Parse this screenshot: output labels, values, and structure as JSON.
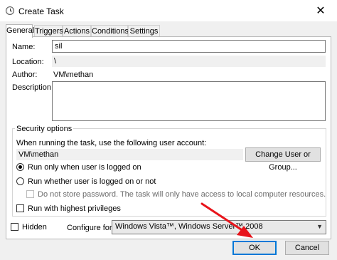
{
  "window": {
    "title": "Create Task",
    "close_glyph": "✕"
  },
  "tabs": [
    {
      "label": "General",
      "active": true
    },
    {
      "label": "Triggers",
      "active": false
    },
    {
      "label": "Actions",
      "active": false
    },
    {
      "label": "Conditions",
      "active": false
    },
    {
      "label": "Settings",
      "active": false
    }
  ],
  "general": {
    "name_label": "Name:",
    "name_value": "sil",
    "location_label": "Location:",
    "location_value": "\\",
    "author_label": "Author:",
    "author_value": "VM\\methan",
    "description_label": "Description:",
    "description_value": ""
  },
  "security": {
    "legend": "Security options",
    "account_prompt": "When running the task, use the following user account:",
    "account_value": "VM\\methan",
    "change_user_button": "Change User or Group...",
    "radio_logged_on": "Run only when user is logged on",
    "radio_logged_on_checked": true,
    "radio_whether": "Run whether user is logged on or not",
    "radio_whether_checked": false,
    "no_store_password": "Do not store password.  The task will only have access to local computer resources.",
    "highest_privileges": "Run with highest privileges",
    "highest_privileges_checked": false
  },
  "footer": {
    "hidden_label": "Hidden",
    "hidden_checked": false,
    "configure_label": "Configure for:",
    "configure_value": "Windows Vista™, Windows Server™ 2008",
    "ok_button": "OK",
    "cancel_button": "Cancel"
  },
  "colors": {
    "annotation_arrow": "#e8141b",
    "accent": "#0078d7"
  }
}
